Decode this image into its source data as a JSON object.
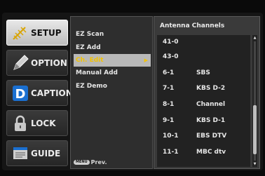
{
  "tabs": [
    {
      "label": "SETUP",
      "icon": "antenna-icon"
    },
    {
      "label": "OPTION",
      "icon": "pen-icon"
    },
    {
      "label": "CAPTION",
      "icon": "d-caption-icon"
    },
    {
      "label": "LOCK",
      "icon": "lock-icon"
    },
    {
      "label": "GUIDE",
      "icon": "guide-icon"
    }
  ],
  "menu": {
    "items": [
      "EZ Scan",
      "EZ Add",
      "Ch. Edit",
      "Manual Add",
      "EZ Demo"
    ],
    "selected": "Ch. Edit",
    "prev_button": "MENU",
    "prev_label": "Prev."
  },
  "panel": {
    "title": "Antenna Channels",
    "channels": [
      {
        "num": "41-0",
        "name": ""
      },
      {
        "num": "43-0",
        "name": ""
      },
      {
        "num": "6-1",
        "name": "SBS"
      },
      {
        "num": "7-1",
        "name": "KBS D-2"
      },
      {
        "num": "8-1",
        "name": "Channel"
      },
      {
        "num": "9-1",
        "name": "KBS D-1"
      },
      {
        "num": "10-1",
        "name": "EBS DTV"
      },
      {
        "num": "11-1",
        "name": "MBC dtv"
      }
    ]
  },
  "colors": {
    "highlight": "#f2c200",
    "selected_bg": "#b8b8b8"
  }
}
